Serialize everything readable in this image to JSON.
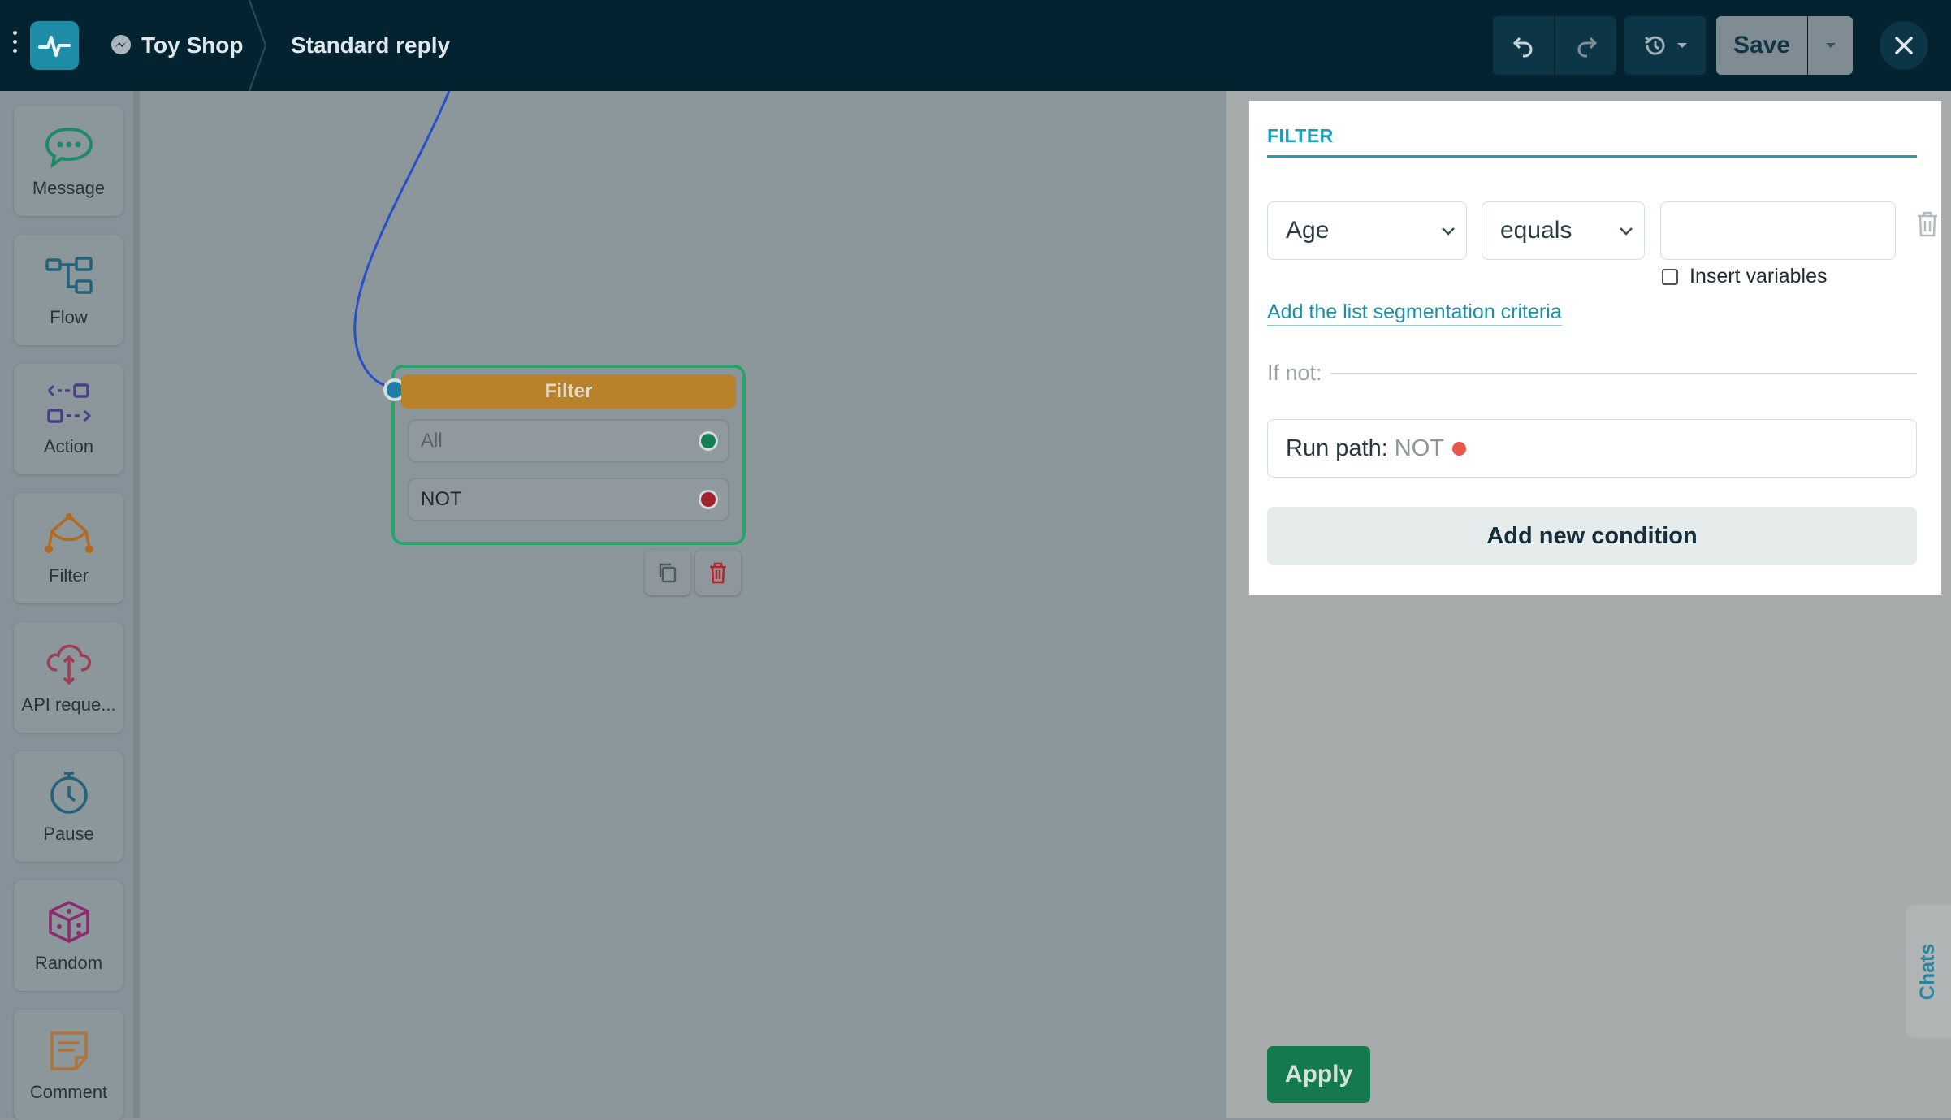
{
  "header": {
    "bot_name": "Toy Shop",
    "flow_title": "Standard reply",
    "save_label": "Save"
  },
  "sidebar": {
    "items": [
      {
        "label": "Message",
        "icon": "message-icon",
        "color": "#1f8a67"
      },
      {
        "label": "Flow",
        "icon": "flow-icon",
        "color": "#23627a"
      },
      {
        "label": "Action",
        "icon": "action-icon",
        "color": "#4a3f86"
      },
      {
        "label": "Filter",
        "icon": "filter-icon",
        "color": "#b36a1e"
      },
      {
        "label": "API reque...",
        "icon": "api-request-icon",
        "color": "#9c3f54"
      },
      {
        "label": "Pause",
        "icon": "pause-icon",
        "color": "#23627a"
      },
      {
        "label": "Random",
        "icon": "random-icon",
        "color": "#8a2d6f"
      },
      {
        "label": "Comment",
        "icon": "comment-icon",
        "color": "#b0743a"
      }
    ]
  },
  "canvas": {
    "node": {
      "title": "Filter",
      "rows": [
        {
          "label": "All",
          "port_color": "#148051"
        },
        {
          "label": "NOT",
          "port_color": "#a1222a"
        }
      ]
    }
  },
  "panel": {
    "title": "FILTER",
    "condition": {
      "field": "Age",
      "operator": "equals",
      "value": ""
    },
    "insert_variables_label": "Insert variables",
    "insert_variables_checked": false,
    "segmentation_link": "Add the list segmentation criteria",
    "if_not_label": "If not:",
    "run_path_label": "Run path:",
    "run_path_value": "NOT",
    "add_condition_label": "Add new condition",
    "apply_label": "Apply",
    "chats_tab_label": "Chats"
  },
  "colors": {
    "topbar": "#042331",
    "accent": "#1aa0b4",
    "apply": "#147a4d",
    "filter_header": "#b8822b",
    "node_border": "#29a36b",
    "wire": "#2b4fc7"
  }
}
